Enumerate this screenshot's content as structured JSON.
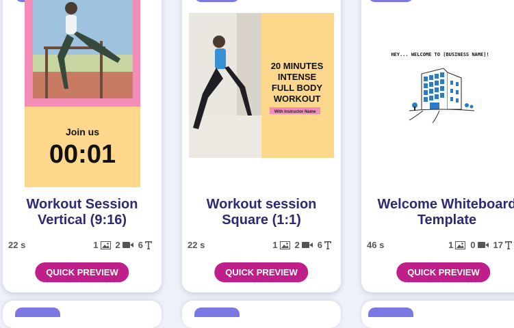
{
  "cards": [
    {
      "title": "Workout Session Vertical (9:16)",
      "duration": "22 s",
      "images": "1",
      "videos": "2",
      "texts": "6",
      "button": "QUICK PREVIEW",
      "thumb_text_1": "Join us",
      "thumb_text_2": "00:01"
    },
    {
      "title": "Workout session Square (1:1)",
      "duration": "22 s",
      "images": "1",
      "videos": "2",
      "texts": "6",
      "button": "QUICK PREVIEW",
      "thumb_text_1": "20 MINUTES INTENSE FULL BODY WORKOUT",
      "thumb_text_2": "With Instructor Name"
    },
    {
      "title": "Welcome Whiteboard Template",
      "duration": "46 s",
      "images": "1",
      "videos": "0",
      "texts": "17",
      "button": "QUICK PREVIEW",
      "thumb_text_1": "HEY... WELCOME TO [BUSINESS NAME]!"
    }
  ],
  "colors": {
    "accent_button": "#bf1f8a",
    "title_text": "#2e2a72",
    "tag": "#7b78e6",
    "pink_frame": "#f48cb8",
    "peach": "#fdd78b"
  },
  "icons": [
    "image-icon",
    "video-icon",
    "text-icon"
  ]
}
